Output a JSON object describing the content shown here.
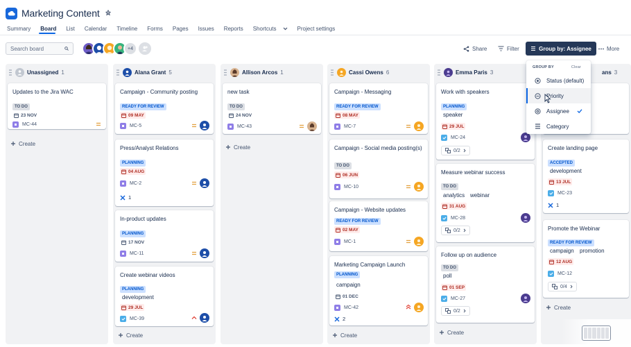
{
  "project": {
    "title": "Marketing Content",
    "icon": "cloud-icon",
    "accent_color": "#1868db"
  },
  "tabs": [
    {
      "label": "Summary"
    },
    {
      "label": "Board",
      "active": true
    },
    {
      "label": "List"
    },
    {
      "label": "Calendar"
    },
    {
      "label": "Timeline"
    },
    {
      "label": "Forms"
    },
    {
      "label": "Pages"
    },
    {
      "label": "Issues"
    },
    {
      "label": "Reports"
    },
    {
      "label": "Shortcuts"
    },
    {
      "label": "Project settings"
    }
  ],
  "toolbar": {
    "search_placeholder": "Search board",
    "avatars_more": "+4",
    "share": "Share",
    "filter": "Filter",
    "group_by": "Group by: Assignee",
    "more": "More"
  },
  "group_menu": {
    "header": "GROUP BY",
    "clear": "Clear",
    "options": [
      {
        "label": "Status (default)",
        "icon": "status-icon"
      },
      {
        "label": "Priority",
        "icon": "priority-icon",
        "hover": true
      },
      {
        "label": "Assignee",
        "icon": "assignee-icon",
        "selected": true
      },
      {
        "label": "Category",
        "icon": "category-icon"
      }
    ]
  },
  "columns": [
    {
      "name": "Unassigned",
      "count": "1",
      "create": "Create",
      "cards": [
        {
          "title": "Updates to the Jira WAC",
          "status": "TO DO",
          "date": "23 NOV",
          "date_overdue": false,
          "key": "MC-44",
          "type": "epic-icon",
          "priority": "medium"
        }
      ]
    },
    {
      "name": "Alana Grant",
      "count": "5",
      "create": "Create",
      "cards": [
        {
          "title": "Campaign - Community posting",
          "status": "READY FOR REVIEW",
          "date": "09 MAY",
          "date_overdue": true,
          "key": "MC-5",
          "type": "epic-icon",
          "priority": "medium"
        },
        {
          "title": "Press/Analyst Relations",
          "status": "PLANNING",
          "date": "04 AUG",
          "date_overdue": true,
          "key": "MC-2",
          "type": "epic-icon",
          "priority": "medium",
          "subtasks": "1"
        },
        {
          "title": "In-product updates",
          "status": "PLANNING",
          "date": "17 NOV",
          "date_overdue": false,
          "key": "MC-11",
          "type": "epic-icon",
          "priority": "medium"
        },
        {
          "title": "Create webinar videos",
          "status": "PLANNING",
          "label": "development",
          "date": "29 JUL",
          "date_overdue": true,
          "key": "MC-39",
          "type": "task-icon",
          "priority": "high"
        }
      ]
    },
    {
      "name": "Allison Arcos",
      "count": "1",
      "create": "Create",
      "cards": [
        {
          "title": "new task",
          "status": "TO DO",
          "date": "24 NOV",
          "date_overdue": false,
          "key": "MC-43",
          "type": "epic-icon",
          "priority": "medium"
        }
      ]
    },
    {
      "name": "Cassi Owens",
      "count": "6",
      "create": "Create",
      "cards": [
        {
          "title": "Campaign - Messaging",
          "status": "READY FOR REVIEW",
          "date": "08 MAY",
          "date_overdue": true,
          "key": "MC-7",
          "type": "epic-icon",
          "priority": "medium"
        },
        {
          "title": "Campaign - Social media posting(s)",
          "status": "TO DO",
          "date": "06 JUN",
          "date_overdue": true,
          "key": "MC-10",
          "type": "epic-icon",
          "priority": "medium"
        },
        {
          "title": "Campaign - Website updates",
          "status": "READY FOR REVIEW",
          "date": "02 MAY",
          "date_overdue": true,
          "key": "MC-1",
          "type": "epic-icon",
          "priority": "medium"
        },
        {
          "title": "Marketing Campaign Launch",
          "status": "PLANNING",
          "label": "campaign",
          "date": "01 DEC",
          "date_overdue": false,
          "key": "MC-42",
          "type": "epic-icon",
          "priority": "highest",
          "subtasks": "2"
        }
      ]
    },
    {
      "name": "Emma Paris",
      "count": "3",
      "create": "Create",
      "cards": [
        {
          "title": "Work with speakers",
          "status": "PLANNING",
          "label": "speaker",
          "date": "29 JUL",
          "date_overdue": true,
          "key": "MC-24",
          "type": "task-icon",
          "progress": "0/2"
        },
        {
          "title": "Measure webinar success",
          "status": "TO DO",
          "labels": [
            "analytics",
            "webinar"
          ],
          "date": "31 AUG",
          "date_overdue": true,
          "key": "MC-28",
          "type": "task-icon",
          "progress": "0/2"
        },
        {
          "title": "Follow up on audience",
          "status": "TO DO",
          "label": "poll",
          "date": "01 SEP",
          "date_overdue": true,
          "key": "MC-27",
          "type": "task-icon",
          "progress": "0/2"
        }
      ]
    },
    {
      "name": "ans",
      "count": "3",
      "create": "Create",
      "cards": [
        {
          "title": "Create landing page",
          "status": "ACCEPTED",
          "label": "development",
          "date": "13 JUL",
          "date_overdue": true,
          "key": "MC-23",
          "type": "task-icon",
          "subtasks": "1"
        },
        {
          "title": "Promote the Webinar",
          "status": "READY FOR REVIEW",
          "labels": [
            "campaign",
            "promotion"
          ],
          "date": "12 AUG",
          "date_overdue": true,
          "key": "MC-12",
          "type": "task-icon",
          "progress": "0/4"
        }
      ]
    }
  ]
}
